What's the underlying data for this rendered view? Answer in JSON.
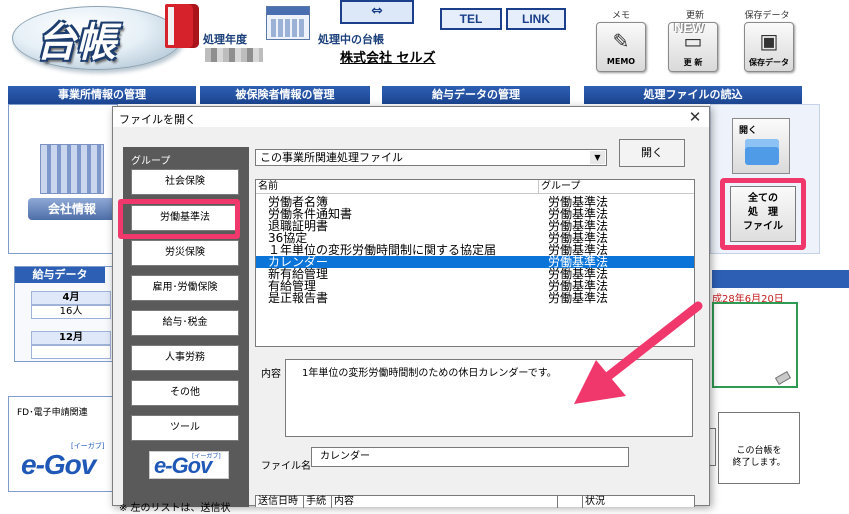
{
  "app": {
    "logo_text": "台帳",
    "label_year": "処理年度",
    "label_current_ledger": "処理中の台帳",
    "company_name": "株式会社 セルズ",
    "switch_glyph": "⇔",
    "tel_label": "TEL",
    "link_label": "LINK",
    "memo_caption": "メモ",
    "memo_label": "MEMO",
    "update_caption": "更新",
    "update_new_badge": "NEW",
    "update_label": "更 新",
    "backup_caption": "保存データ",
    "backup_label": "保存データ"
  },
  "sections": {
    "office": "事業所情報の管理",
    "insured": "被保険者情報の管理",
    "salary": "給与データの管理",
    "process_files": "処理ファイルの読込"
  },
  "left": {
    "office_info_label": "会社情報",
    "salary_data_header": "給与データ",
    "salary_month_apr": "4月",
    "salary_count_apr": "16人",
    "salary_month_dec": "12月",
    "fd_label": "FD･電子申請関連",
    "egov_logo": "e-Gov",
    "egov_small": "[イーガブ]"
  },
  "right": {
    "open_caption": "開く",
    "all_files_label": "全ての\n処　理\nファイル",
    "date_text": "成28年6月20日",
    "close_ledger_label": "この台帳を\n終了します。"
  },
  "dialog": {
    "title": "ファイルを開く",
    "close_glyph": "✕",
    "group_caption": "グループ",
    "groups": [
      "社会保険",
      "労働基準法",
      "労災保険",
      "雇用･労働保険",
      "給与･税金",
      "人事労務",
      "その他",
      "ツール"
    ],
    "egov_logo": "e-Gov",
    "egov_small": "[イーガブ]",
    "scope_select_value": "この事業所関連処理ファイル",
    "scope_select_arrow": "▼",
    "open_button": "開く",
    "col_name": "名前",
    "col_group": "グループ",
    "files": [
      {
        "name": "労働者名簿",
        "group": "労働基準法"
      },
      {
        "name": "労働条件通知書",
        "group": "労働基準法"
      },
      {
        "name": "退職証明書",
        "group": "労働基準法"
      },
      {
        "name": "36協定",
        "group": "労働基準法"
      },
      {
        "name": "１年単位の変形労働時間制に関する協定届",
        "group": "労働基準法"
      },
      {
        "name": "カレンダー",
        "group": "労働基準法"
      },
      {
        "name": "新有給管理",
        "group": "労働基準法"
      },
      {
        "name": "有給管理",
        "group": "労働基準法"
      },
      {
        "name": "是正報告書",
        "group": "労働基準法"
      }
    ],
    "selected_index": 5,
    "content_label": "内容",
    "content_text": "1年単位の変形労働時間制のための休日カレンダーです。",
    "filename_label": "ファイル名",
    "filename_value": "カレンダー",
    "notice_text": "※ 左のリストは、送信状",
    "log_cols": [
      "送信日時",
      "手続",
      "内容",
      "状況"
    ]
  },
  "colors": {
    "section_tab": "#1c4590",
    "highlight": "#f0386d",
    "selected_row": "#0a74d9",
    "arrow": "#f0386d"
  },
  "icons": {
    "logo": "ledger-logo",
    "book": "book-icon",
    "calendar": "calendar-icon",
    "memo": "memo-icon",
    "update": "update-icon",
    "backup": "briefcase-icon",
    "folder": "folder-icon",
    "building": "building-icon",
    "arrow": "pink-arrow-annotation"
  }
}
